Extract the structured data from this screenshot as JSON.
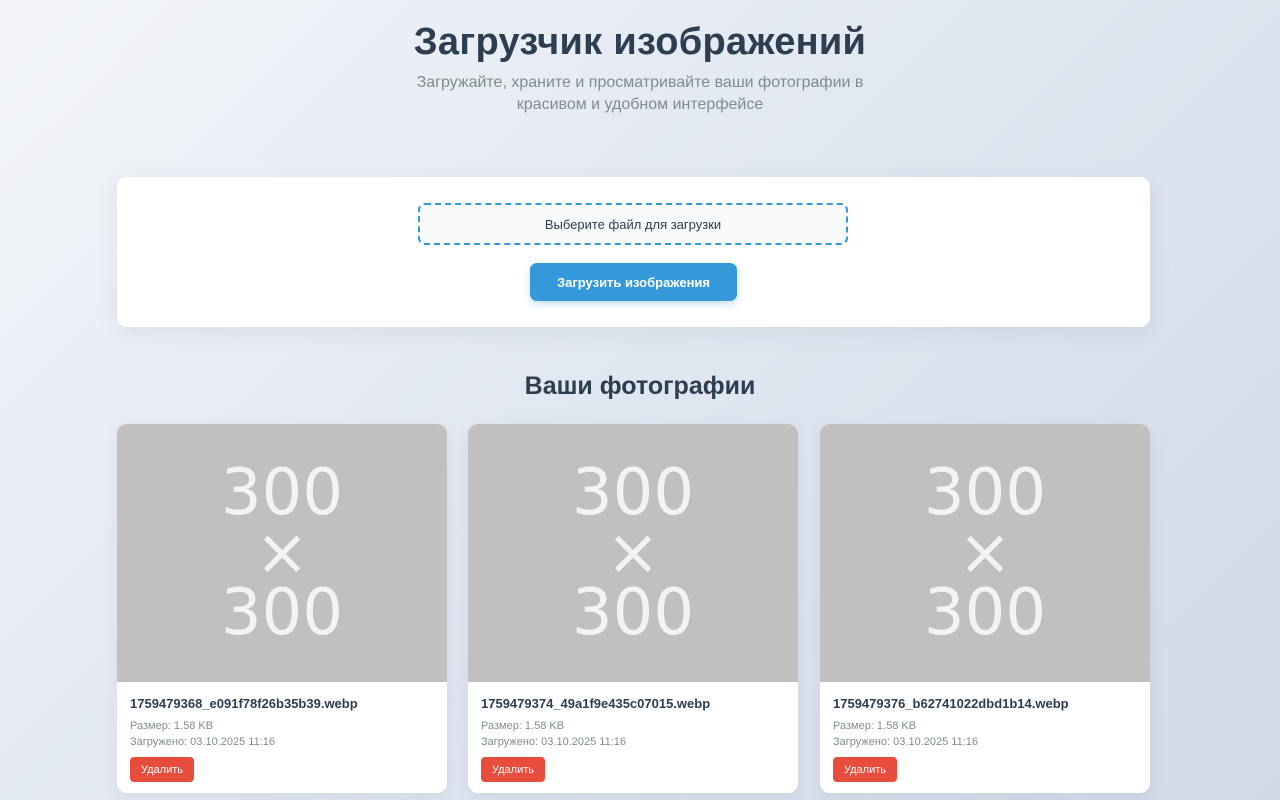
{
  "header": {
    "title": "Загрузчик изображений",
    "subtitle": "Загружайте, храните и просматривайте ваши фотографии в красивом и удобном интерфейсе"
  },
  "upload": {
    "file_picker_label": "Выберите файл для загрузки",
    "upload_button_label": "Загрузить изображения"
  },
  "gallery": {
    "title": "Ваши фотографии",
    "photos": [
      {
        "placeholder": "300\n×\n300",
        "filename": "1759479368_e091f78f26b35b39.webp",
        "size": "Размер: 1.58 KB",
        "uploaded": "Загружено: 03.10.2025 11:16",
        "delete_label": "Удалить"
      },
      {
        "placeholder": "300\n×\n300",
        "filename": "1759479374_49a1f9e435c07015.webp",
        "size": "Размер: 1.58 KB",
        "uploaded": "Загружено: 03.10.2025 11:16",
        "delete_label": "Удалить"
      },
      {
        "placeholder": "300\n×\n300",
        "filename": "1759479376_b62741022dbd1b14.webp",
        "size": "Размер: 1.58 KB",
        "uploaded": "Загружено: 03.10.2025 11:16",
        "delete_label": "Удалить"
      }
    ]
  },
  "colors": {
    "accent": "#3498db",
    "danger": "#e74c3c",
    "text": "#2c3e50",
    "muted": "#7f8c8d",
    "placeholder_bg": "#c2bfbf"
  }
}
